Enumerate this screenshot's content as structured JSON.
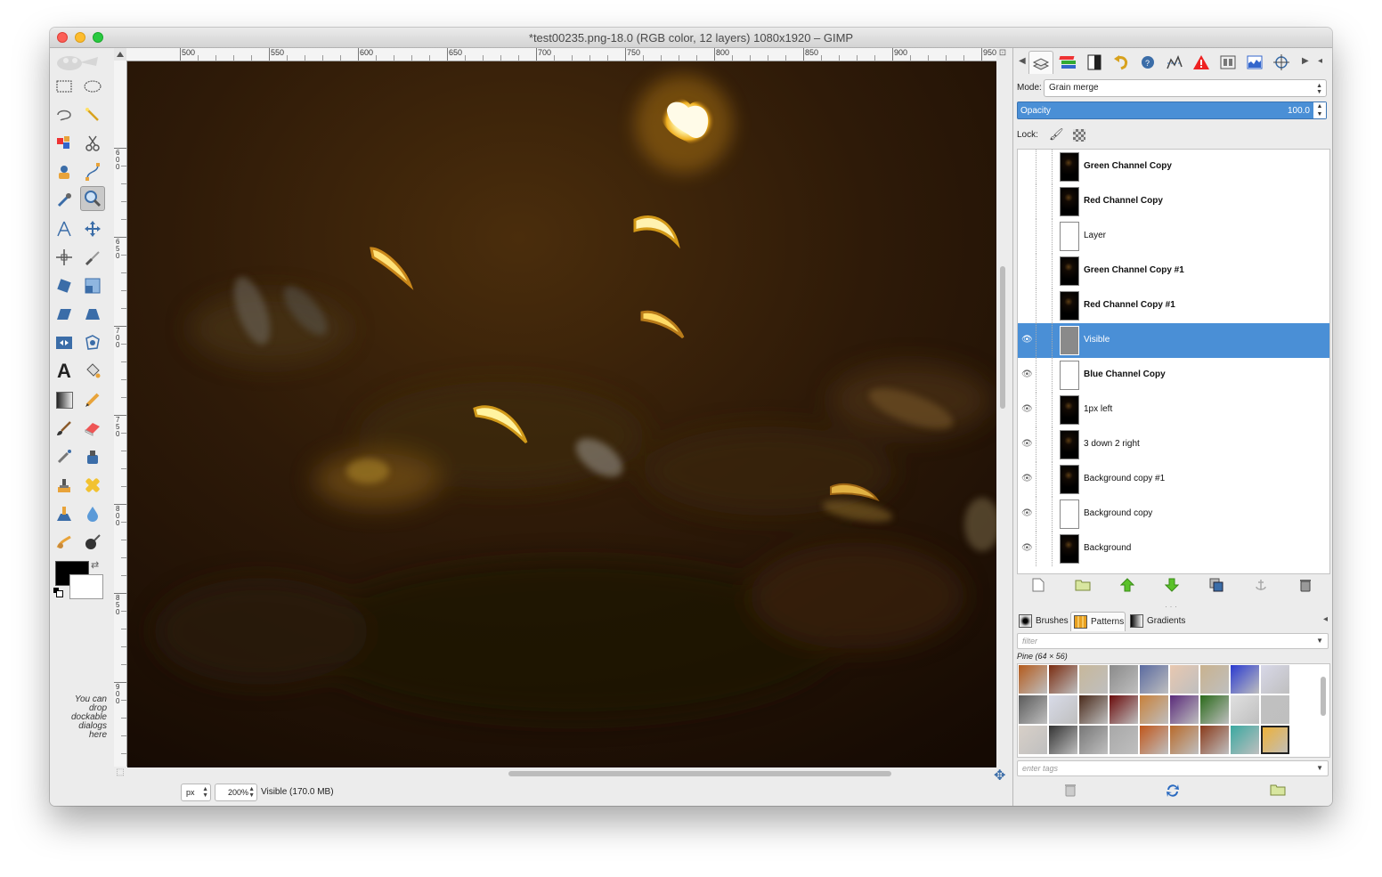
{
  "window": {
    "title": "*test00235.png-18.0 (RGB color, 12 layers) 1080x1920 – GIMP"
  },
  "toolbox": {
    "drop_hint": "You can drop dockable dialogs here",
    "tools": [
      "rect-select",
      "ellipse-select",
      "free-select",
      "fuzzy-select",
      "select-by-color",
      "scissors-select",
      "foreground-select",
      "paths",
      "color-picker",
      "zoom",
      "measure",
      "move",
      "align",
      "crop",
      "rotate",
      "scale",
      "shear",
      "perspective",
      "flip",
      "cage-transform",
      "text",
      "bucket-fill",
      "blend",
      "pencil",
      "paintbrush",
      "eraser",
      "airbrush",
      "ink",
      "clone",
      "heal",
      "perspective-clone",
      "blur-sharpen",
      "smudge",
      "dodge-burn"
    ],
    "active_tool": "zoom",
    "fg_color": "#000000",
    "bg_color": "#ffffff"
  },
  "ruler": {
    "top_labels": [
      "500",
      "550",
      "600",
      "650",
      "700",
      "750",
      "800",
      "850",
      "900",
      "950"
    ],
    "left_labels": [
      "6\n0\n0",
      "6\n5\n0",
      "7\n0\n0",
      "7\n5\n0",
      "8\n0\n0",
      "8\n5\n0",
      "9\n0\n0"
    ]
  },
  "statusbar": {
    "unit": "px",
    "zoom": "200%",
    "status": "Visible (170.0 MB)"
  },
  "dock": {
    "tabs": [
      "layers-icon",
      "channels-icon",
      "paths-icon",
      "undo-history-icon",
      "pointer-icon",
      "dynamics-icon",
      "error-console-icon",
      "device-status-icon",
      "histogram-icon",
      "sample-points-icon"
    ],
    "mode_label": "Mode:",
    "mode_value": "Grain merge",
    "opacity_label": "Opacity",
    "opacity_value": "100.0",
    "lock_label": "Lock:"
  },
  "layers": [
    {
      "name": "Green Channel Copy",
      "bold": true,
      "visible": false,
      "thumb": "dark"
    },
    {
      "name": "Red Channel Copy",
      "bold": true,
      "visible": false,
      "thumb": "dark"
    },
    {
      "name": "Layer",
      "bold": false,
      "visible": false,
      "thumb": "white"
    },
    {
      "name": "Green Channel Copy #1",
      "bold": true,
      "visible": false,
      "thumb": "dark"
    },
    {
      "name": "Red Channel Copy #1",
      "bold": true,
      "visible": false,
      "thumb": "dark"
    },
    {
      "name": "Visible",
      "bold": false,
      "visible": true,
      "thumb": "gray",
      "selected": true
    },
    {
      "name": "Blue Channel Copy",
      "bold": true,
      "visible": true,
      "thumb": "white"
    },
    {
      "name": "1px left",
      "bold": false,
      "visible": true,
      "thumb": "dark"
    },
    {
      "name": "3 down 2 right",
      "bold": false,
      "visible": true,
      "thumb": "dark"
    },
    {
      "name": "Background copy #1",
      "bold": false,
      "visible": true,
      "thumb": "dark"
    },
    {
      "name": "Background copy",
      "bold": false,
      "visible": true,
      "thumb": "white"
    },
    {
      "name": "Background",
      "bold": false,
      "visible": true,
      "thumb": "dark"
    }
  ],
  "resources": {
    "tabs": [
      "Brushes",
      "Patterns",
      "Gradients"
    ],
    "active_tab": "Patterns",
    "filter_placeholder": "filter",
    "selected_pattern": "Pine (64 × 56)",
    "tags_placeholder": "enter tags"
  }
}
